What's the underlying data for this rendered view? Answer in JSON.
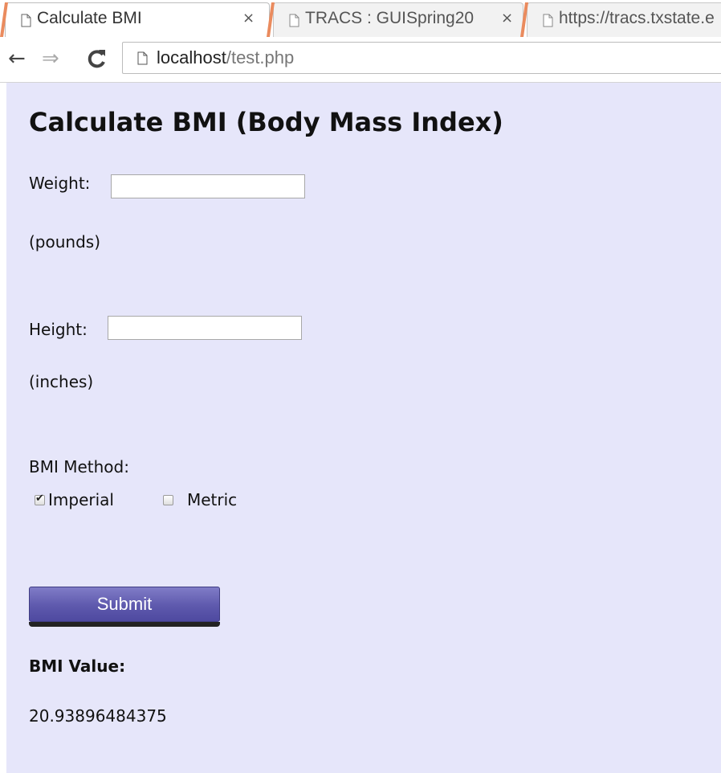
{
  "browser": {
    "tabs": [
      {
        "title": "Calculate BMI",
        "active": true
      },
      {
        "title": "TRACS : GUISpring20",
        "active": false
      },
      {
        "title": "https://tracs.txstate.e",
        "active": false
      }
    ],
    "close_glyph": "×",
    "url_host": "localhost",
    "url_path": "/test.php"
  },
  "page": {
    "heading": "Calculate BMI (Body Mass Index)",
    "weight_label": "Weight:",
    "weight_value": "",
    "weight_unit": "(pounds)",
    "height_label": "Height:",
    "height_value": "",
    "height_unit": "(inches)",
    "method_label": "BMI Method:",
    "method_options": [
      {
        "label": "Imperial",
        "checked": true
      },
      {
        "label": "Metric",
        "checked": false
      }
    ],
    "submit_label": "Submit",
    "result_label": "BMI Value:",
    "result_value": "20.93896484375"
  },
  "colors": {
    "page_background": "#e6e6fa",
    "button_primary": "#5e59ad",
    "tab_accent": "#ea8b5e"
  }
}
